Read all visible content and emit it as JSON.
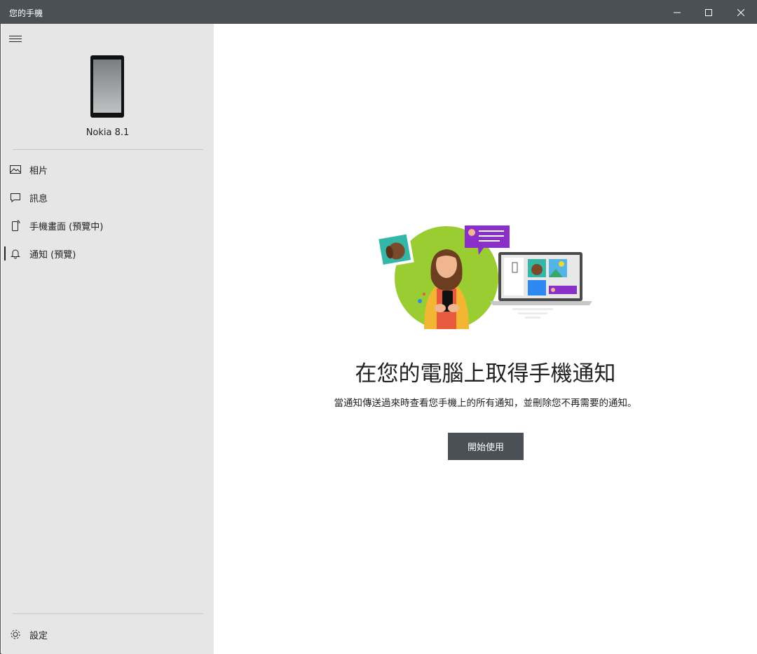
{
  "window": {
    "title": "您的手機",
    "controls": [
      "minimize-icon",
      "maximize-icon",
      "close-icon"
    ]
  },
  "sidebar": {
    "device_name": "Nokia 8.1",
    "items": [
      {
        "label": "相片",
        "icon": "photo-icon",
        "active": false
      },
      {
        "label": "訊息",
        "icon": "message-icon",
        "active": false
      },
      {
        "label": "手機畫面 (預覽中)",
        "icon": "phone-screen-icon",
        "active": false
      },
      {
        "label": "通知 (預覽)",
        "icon": "bell-icon",
        "active": true
      }
    ],
    "settings_label": "設定"
  },
  "main": {
    "headline": "在您的電腦上取得手機通知",
    "description": "當通知傳送過來時查看您手機上的所有通知，並刪除您不再需要的通知。",
    "cta_label": "開始使用"
  },
  "colors": {
    "titlebar": "#4a5056",
    "sidebar": "#e6e6e6",
    "button": "#4a5056",
    "illustration_green": "#9acd32",
    "illustration_purple": "#8b2fc9"
  }
}
